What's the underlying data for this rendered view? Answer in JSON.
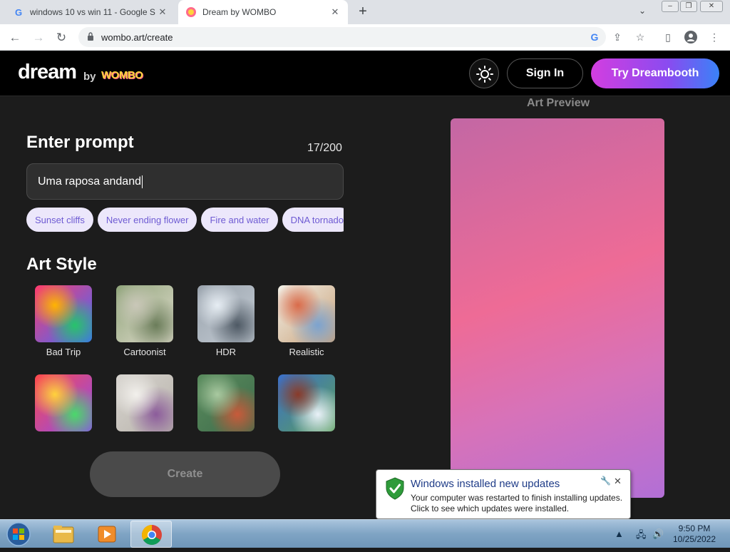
{
  "browser": {
    "tabs": [
      {
        "title": "windows 10 vs win 11 - Google S",
        "favicon": "G"
      },
      {
        "title": "Dream by WOMBO",
        "favicon": "wombo"
      }
    ],
    "url": "wombo.art/create"
  },
  "site": {
    "logo": "dream",
    "logo_by": "by",
    "logo_brand": "WOMBO",
    "sign_in": "Sign In",
    "try_dreambooth": "Try Dreambooth"
  },
  "prompt": {
    "title": "Enter prompt",
    "count": "17/200",
    "value": "Uma raposa andand",
    "suggestions": [
      "Sunset cliffs",
      "Never ending flower",
      "Fire and water",
      "DNA tornado"
    ]
  },
  "art_style": {
    "title": "Art Style",
    "styles": [
      {
        "label": "Bad Trip",
        "colors": [
          "#ff3b6b",
          "#ffb400",
          "#27c46b",
          "#3b6bff"
        ]
      },
      {
        "label": "Cartoonist",
        "colors": [
          "#8fa47a",
          "#c9c7b8",
          "#6b7d5a",
          "#e0dccd"
        ]
      },
      {
        "label": "HDR",
        "colors": [
          "#9aa3ad",
          "#e6edf3",
          "#4e5964",
          "#c4ccd4"
        ]
      },
      {
        "label": "Realistic",
        "colors": [
          "#f2efe6",
          "#d96b4a",
          "#7ca3cf",
          "#c9a27a"
        ]
      },
      {
        "label": "",
        "colors": [
          "#ff4a4a",
          "#ffd23b",
          "#4ad96b",
          "#8a4bf0"
        ]
      },
      {
        "label": "",
        "colors": [
          "#d8d5d0",
          "#f2f0ec",
          "#8c5c9b",
          "#b7b2aa"
        ]
      },
      {
        "label": "",
        "colors": [
          "#5a8c5e",
          "#a9c9a0",
          "#c85a3a",
          "#3e6b4a"
        ]
      },
      {
        "label": "",
        "colors": [
          "#3b6fc9",
          "#8a3b2a",
          "#e9f1f8",
          "#5aa05a"
        ]
      }
    ]
  },
  "create_label": "Create",
  "preview": {
    "title": "Art Preview"
  },
  "notification": {
    "title": "Windows installed new updates",
    "text": "Your computer was restarted to finish installing updates. Click to see which updates were installed."
  },
  "taskbar": {
    "time": "9:50 PM",
    "date": "10/25/2022"
  }
}
